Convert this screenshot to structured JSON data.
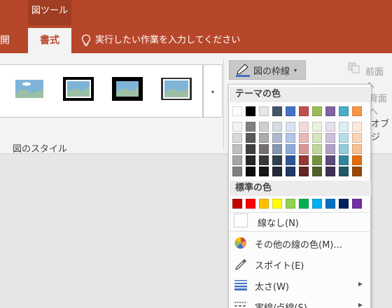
{
  "ribbon": {
    "context_tab": "図ツール",
    "tabs": {
      "dev": "開発",
      "format": "書式"
    },
    "tell_me": "実行したい作業を入力してください",
    "group_label": "図のスタイル",
    "border_button": "図の枠線",
    "right": {
      "bring_forward": "前面へ",
      "send_backward": "背面へ",
      "objects": "オブジ"
    }
  },
  "menu": {
    "theme_header": "テーマの色",
    "standard_header": "標準の色",
    "items": {
      "no_line": "線なし(N)",
      "more_colors": "その他の線の色(M)...",
      "eyedropper": "スポイト(E)",
      "weight": "太さ(W)",
      "dashes": "実線/点線(S)"
    },
    "theme_colors": [
      [
        "#ffffff",
        "#000000",
        "#e7e6e6",
        "#44546a",
        "#4472c4",
        "#c0504d",
        "#9bbb59",
        "#8064a2",
        "#4bacc6",
        "#f79646"
      ],
      [
        "#f2f2f2",
        "#7f7f7f",
        "#d0cece",
        "#d6dce4",
        "#dae3f3",
        "#f2dcdb",
        "#ebf1dd",
        "#e5e0ec",
        "#dbeef3",
        "#fde9d9"
      ],
      [
        "#d8d8d8",
        "#595959",
        "#aeaaaa",
        "#adb9ca",
        "#b4c6e7",
        "#e6b8b7",
        "#d7e3bc",
        "#ccc1d9",
        "#b7dde8",
        "#fbd5b5"
      ],
      [
        "#bfbfbf",
        "#3f3f3f",
        "#757070",
        "#8496b0",
        "#8eaadb",
        "#da9694",
        "#c3d69b",
        "#b2a2c7",
        "#92cddc",
        "#fac08f"
      ],
      [
        "#a5a5a5",
        "#262626",
        "#3a3838",
        "#323f4f",
        "#2f5496",
        "#953734",
        "#76923c",
        "#5f497a",
        "#31859b",
        "#e36c09"
      ],
      [
        "#7f7f7f",
        "#0c0c0c",
        "#171616",
        "#222a35",
        "#1f3864",
        "#632523",
        "#4f6128",
        "#3f3151",
        "#205867",
        "#974806"
      ]
    ],
    "standard_colors": [
      "#c00000",
      "#ff0000",
      "#ffc000",
      "#ffff00",
      "#92d050",
      "#00b050",
      "#00b0f0",
      "#0070c0",
      "#002060",
      "#7030a0"
    ]
  }
}
